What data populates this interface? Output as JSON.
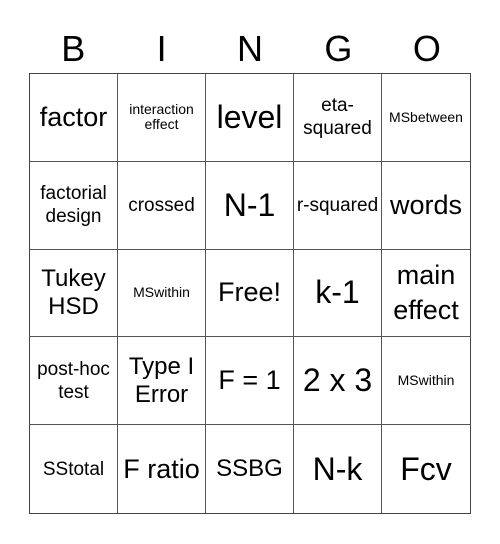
{
  "header": [
    "B",
    "I",
    "N",
    "G",
    "O"
  ],
  "cells": [
    {
      "text": "factor",
      "size": "s-lg"
    },
    {
      "text": "interaction effect",
      "size": "s-xs"
    },
    {
      "text": "level",
      "size": "s-xl"
    },
    {
      "text": "eta-squared",
      "size": "s-sm"
    },
    {
      "text": "MSbetween",
      "size": "s-xs"
    },
    {
      "text": "factorial design",
      "size": "s-sm"
    },
    {
      "text": "crossed",
      "size": "s-sm"
    },
    {
      "text": "N-1",
      "size": "s-xl"
    },
    {
      "text": "r-squared",
      "size": "s-sm"
    },
    {
      "text": "words",
      "size": "s-lg"
    },
    {
      "text": "Tukey HSD",
      "size": "s-md"
    },
    {
      "text": "MSwithin",
      "size": "s-xs"
    },
    {
      "text": "Free!",
      "size": "s-lg"
    },
    {
      "text": "k-1",
      "size": "s-xl"
    },
    {
      "text": "main effect",
      "size": "s-lg"
    },
    {
      "text": "post-hoc test",
      "size": "s-sm"
    },
    {
      "text": "Type I Error",
      "size": "s-md"
    },
    {
      "text": "F = 1",
      "size": "s-lg"
    },
    {
      "text": "2 x 3",
      "size": "s-xl"
    },
    {
      "text": "MSwithin",
      "size": "s-xs"
    },
    {
      "text": "SStotal",
      "size": "s-sm"
    },
    {
      "text": "F ratio",
      "size": "s-lg"
    },
    {
      "text": "SSBG",
      "size": "s-md"
    },
    {
      "text": "N-k",
      "size": "s-xl"
    },
    {
      "text": "Fcv",
      "size": "s-xl"
    }
  ]
}
